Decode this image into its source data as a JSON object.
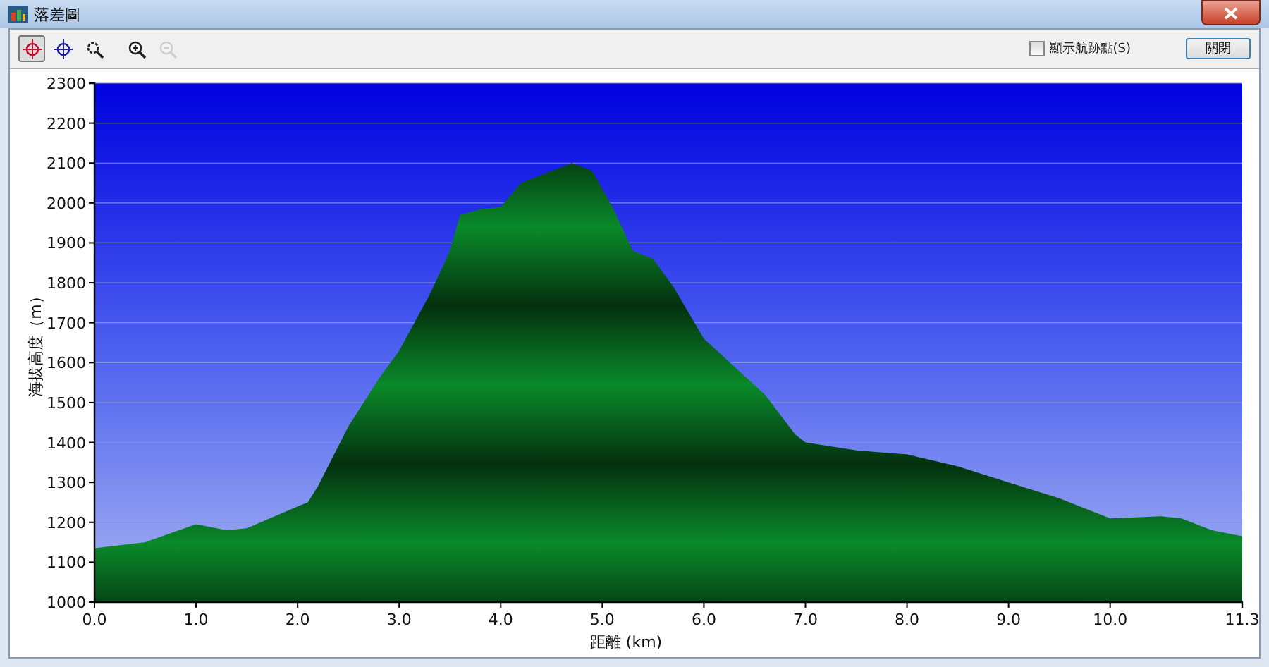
{
  "window": {
    "title": "落差圖"
  },
  "toolbar": {
    "tools": [
      {
        "kind": "crosshair-red",
        "selected": true,
        "disabled": false
      },
      {
        "kind": "crosshair-blue",
        "selected": false,
        "disabled": false
      },
      {
        "kind": "zoom-box",
        "selected": false,
        "disabled": false
      },
      {
        "kind": "zoom-in",
        "selected": false,
        "disabled": false
      },
      {
        "kind": "zoom-out",
        "selected": false,
        "disabled": true
      }
    ],
    "show_points": {
      "label": "顯示航跡點(S)",
      "checked": false
    },
    "close_button": "關閉"
  },
  "chart": {
    "chart_data": {
      "type": "area",
      "xlabel": "距離 (km)",
      "ylabel": "海拔高度（m）",
      "x": [
        0,
        0.5,
        1.0,
        1.3,
        1.5,
        2.0,
        2.1,
        2.2,
        2.5,
        2.8,
        3.0,
        3.3,
        3.5,
        3.6,
        3.8,
        4.0,
        4.2,
        4.5,
        4.7,
        4.9,
        5.1,
        5.3,
        5.5,
        5.7,
        6.0,
        6.3,
        6.6,
        6.9,
        7.0,
        7.5,
        8.0,
        8.5,
        9.0,
        9.5,
        10.0,
        10.5,
        10.7,
        11.0,
        11.3
      ],
      "series": [
        {
          "color": "#0a8a2a",
          "values": [
            1135,
            1150,
            1195,
            1180,
            1185,
            1240,
            1250,
            1290,
            1440,
            1560,
            1630,
            1770,
            1880,
            1970,
            1985,
            1990,
            2050,
            2080,
            2100,
            2080,
            1990,
            1880,
            1860,
            1790,
            1660,
            1590,
            1520,
            1420,
            1400,
            1380,
            1370,
            1340,
            1300,
            1260,
            1210,
            1215,
            1210,
            1180,
            1165
          ]
        }
      ],
      "grid": true,
      "xlim": [
        0,
        11.3
      ],
      "ylim": [
        1000,
        2300
      ],
      "xticks": [
        {
          "value": 0,
          "label": "0.0"
        },
        {
          "value": 1,
          "label": "1.0"
        },
        {
          "value": 2,
          "label": "2.0"
        },
        {
          "value": 3,
          "label": "3.0"
        },
        {
          "value": 4,
          "label": "4.0"
        },
        {
          "value": 5,
          "label": "5.0"
        },
        {
          "value": 6,
          "label": "6.0"
        },
        {
          "value": 7,
          "label": "7.0"
        },
        {
          "value": 8,
          "label": "8.0"
        },
        {
          "value": 9,
          "label": "9.0"
        },
        {
          "value": 10,
          "label": "10.0"
        },
        {
          "value": 11.3,
          "label": "11.3"
        }
      ],
      "yticks": [
        1000,
        1100,
        1200,
        1300,
        1400,
        1500,
        1600,
        1700,
        1800,
        1900,
        2000,
        2100,
        2200,
        2300
      ]
    }
  }
}
